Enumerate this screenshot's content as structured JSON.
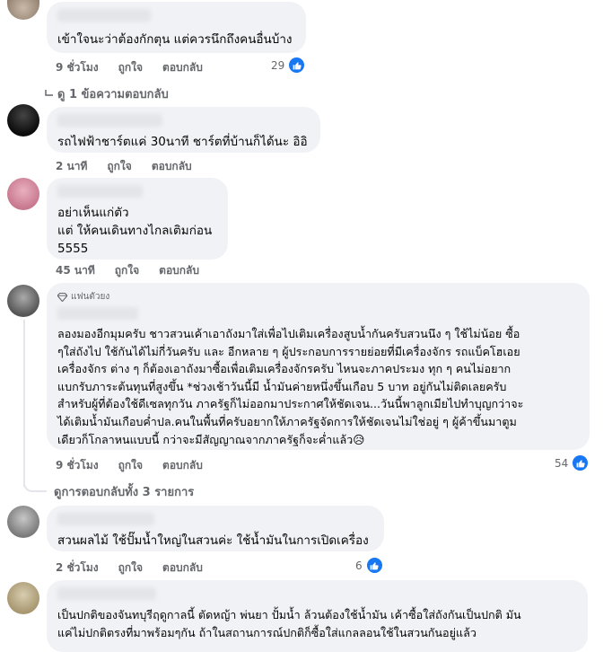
{
  "comments": [
    {
      "text": "เข้าใจนะว่าต้องกักตุน แต่ควรนึกถึงคนอื่นบ้าง",
      "time": "9 ชั่วโมง",
      "likes": "29"
    },
    {
      "text": "รถไฟฟ้าชาร์ตแค่ 30นาที ชาร์ตที่บ้านก็ได้นะ อิอิ",
      "time": "2 นาที",
      "likes": ""
    },
    {
      "text": "อย่าเห็นแก่ตัว\nแต่ ให้คนเดินทางไกลเติมก่อน\n5555",
      "time": "45 นาที",
      "likes": ""
    },
    {
      "badge": "แฟนตัวยง",
      "text": "ลองมองอีกมุมครับ ชาวสวนเค้าเอาถังมาใส่เพื่อไปเติมเครื่องสูบน้ำกันครับสวนนึง ๆ ใช้ไม่น้อย ซื้อ\nๆใส่ถังไป ใช้กันได้ไม่กี่วันครับ และ อีกหลาย ๆ ผู้ประกอบการรายย่อยที่มีเครื่องจักร รถแบ็คโฮเอย\nเครื่องจักร ต่าง ๆ ก็ต้องเอาถังมาซื้อเพื่อเติมเครื่องจักรครับ ไหนจะภาคประมง ทุก ๆ คนไม่อยาก\nแบกรับภาระต้นทุนที่สูงขึ้น *ช่วงเช้าวันนี้มี น้ำมันค่ายหนึ่งขึ้นเกือบ 5 บาท อยู่กันไม่ติดเลยครับ\nสำหรับผู้ที่ต้องใช้ดีเซลทุกวัน ภาครัฐก็ไม่ออกมาประกาศให้ชัดเจน...วันนี้พาลูกเมียไปทำบุญกว่าจะ\nได้เติมน้ำมันเกือบค่ำปล.คนในพื้นที่ครับอยากให้ภาครัฐจัดการให้ชัดเจนไม่ใช่อยู่ ๆ ผู้ค้าขึ้นมาตูม\nเดียวก็โกลาหนแบบนี้ กว่าจะมีสัญญาณจากภาครัฐก็จะค่ำแล้ว😥",
      "time": "9 ชั่วโมง",
      "likes": "54"
    },
    {
      "text": "สวนผลไม้ ใช้ปั๊มน้ำใหญ่ในสวนค่ะ ใช้น้ำมันในการเปิดเครื่อง",
      "time": "2 ชั่วโมง",
      "likes": "6"
    },
    {
      "text": "เป็นปกติของจันทบุรีฤดูกาลนี้ ตัดหญ้า พ่นยา ปั้มน้ำ ล้วนต้องใช้น้ำมัน เค้าซื้อใส่ถังกันเป็นปกติ มัน\nแค่ไม่ปกติตรงที่มาพร้อมๆกัน ถ้าในสถานการณ์ปกติก็ซื้อใส่แกลลอนใช้ในสวนกันอยู่แล้ว"
    }
  ],
  "ui": {
    "like_label": "ถูกใจ",
    "reply_label": "ตอบกลับ",
    "view_one_reply": "ดู 1 ข้อความตอบกลับ",
    "view_all_replies": "ดูการตอบกลับทั้ง 3 รายการ"
  },
  "colors": {
    "bubble": "#f0f2f5",
    "meta_text": "#65676b",
    "like_blue": "#1877f2"
  }
}
